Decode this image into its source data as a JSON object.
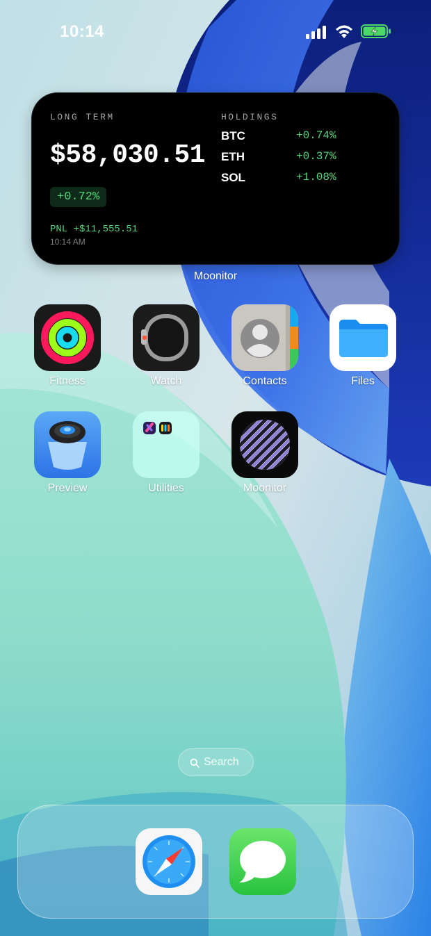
{
  "status_bar": {
    "time": "10:14",
    "battery_state": "charging",
    "icons": [
      "cellular-signal-icon",
      "wifi-icon",
      "battery-charging-icon"
    ]
  },
  "widget": {
    "app_name": "Moonitor",
    "portfolio_label": "LONG TERM",
    "portfolio_value": "$58,030.51",
    "portfolio_change": "+0.72%",
    "pnl": "PNL +$11,555.51",
    "updated_time": "10:14 AM",
    "holdings_label": "HOLDINGS",
    "holdings": [
      {
        "symbol": "BTC",
        "change": "+0.74%"
      },
      {
        "symbol": "ETH",
        "change": "+0.37%"
      },
      {
        "symbol": "SOL",
        "change": "+1.08%"
      }
    ],
    "colors": {
      "positive": "#53d47a",
      "background": "#000000"
    }
  },
  "apps": [
    {
      "label": "Fitness",
      "icon": "fitness-rings-icon"
    },
    {
      "label": "Watch",
      "icon": "watch-icon"
    },
    {
      "label": "Contacts",
      "icon": "contacts-icon"
    },
    {
      "label": "Files",
      "icon": "folder-icon"
    },
    {
      "label": "Preview",
      "icon": "preview-icon"
    },
    {
      "label": "Utilities",
      "icon": "folder-group-icon"
    },
    {
      "label": "Moonitor",
      "icon": "moonitor-icon"
    }
  ],
  "search": {
    "label": "Search",
    "icon": "search-icon"
  },
  "dock": [
    {
      "name": "Safari",
      "icon": "safari-compass-icon"
    },
    {
      "name": "Messages",
      "icon": "messages-bubble-icon"
    }
  ]
}
